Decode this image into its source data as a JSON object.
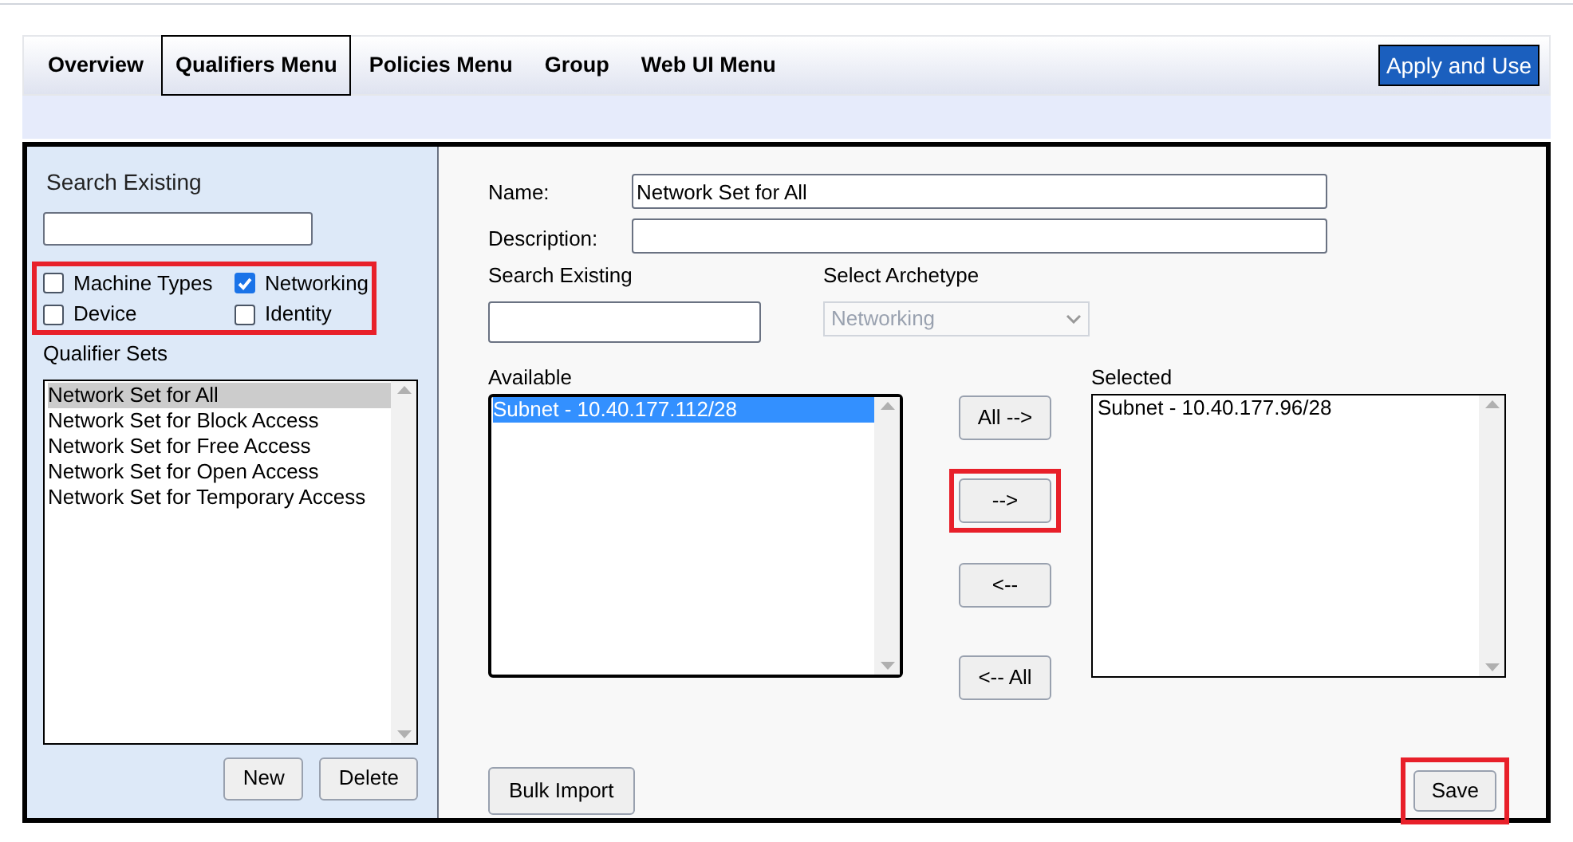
{
  "tabs": [
    {
      "label": "Overview",
      "selected": false
    },
    {
      "label": "Qualifiers Menu",
      "selected": true
    },
    {
      "label": "Policies Menu",
      "selected": false
    },
    {
      "label": "Group",
      "selected": false
    },
    {
      "label": "Web UI Menu",
      "selected": false
    }
  ],
  "apply_button": "Apply and Use",
  "sidebar": {
    "search_label": "Search Existing",
    "type_filters": {
      "highlighted": true,
      "items": [
        {
          "label": "Machine Types",
          "checked": false
        },
        {
          "label": "Networking",
          "checked": true
        },
        {
          "label": "Device",
          "checked": false
        },
        {
          "label": "Identity",
          "checked": false
        }
      ]
    },
    "qualifier_sets": {
      "label": "Qualifier Sets",
      "items": [
        {
          "label": "Network Set for All",
          "selected": true
        },
        {
          "label": "Network Set for Block Access",
          "selected": false
        },
        {
          "label": "Network Set for Free Access",
          "selected": false
        },
        {
          "label": "Network Set for Open Access",
          "selected": false
        },
        {
          "label": "Network Set for Temporary Access",
          "selected": false
        }
      ]
    },
    "buttons": [
      "New",
      "Delete"
    ]
  },
  "form": {
    "name": {
      "label": "Name:",
      "value": "Network Set for All"
    },
    "description": {
      "label": "Description:"
    },
    "search_label": "Search Existing",
    "archetype": {
      "label": "Select Archetype",
      "value": "Networking",
      "disabled": true
    },
    "available": {
      "label": "Available",
      "items": [
        {
          "label": "Subnet - 10.40.177.112/28",
          "selected": true
        }
      ]
    },
    "transfer_buttons": [
      {
        "label": "All -->",
        "highlighted": false
      },
      {
        "label": "-->",
        "highlighted": true
      },
      {
        "label": "<--",
        "highlighted": false
      },
      {
        "label": "<-- All",
        "highlighted": false
      }
    ],
    "selected": {
      "label": "Selected",
      "items": [
        {
          "label": "Subnet - 10.40.177.96/28",
          "selected": false
        }
      ]
    },
    "bulk_import": "Bulk Import",
    "save": {
      "label": "Save",
      "highlighted": true
    }
  }
}
